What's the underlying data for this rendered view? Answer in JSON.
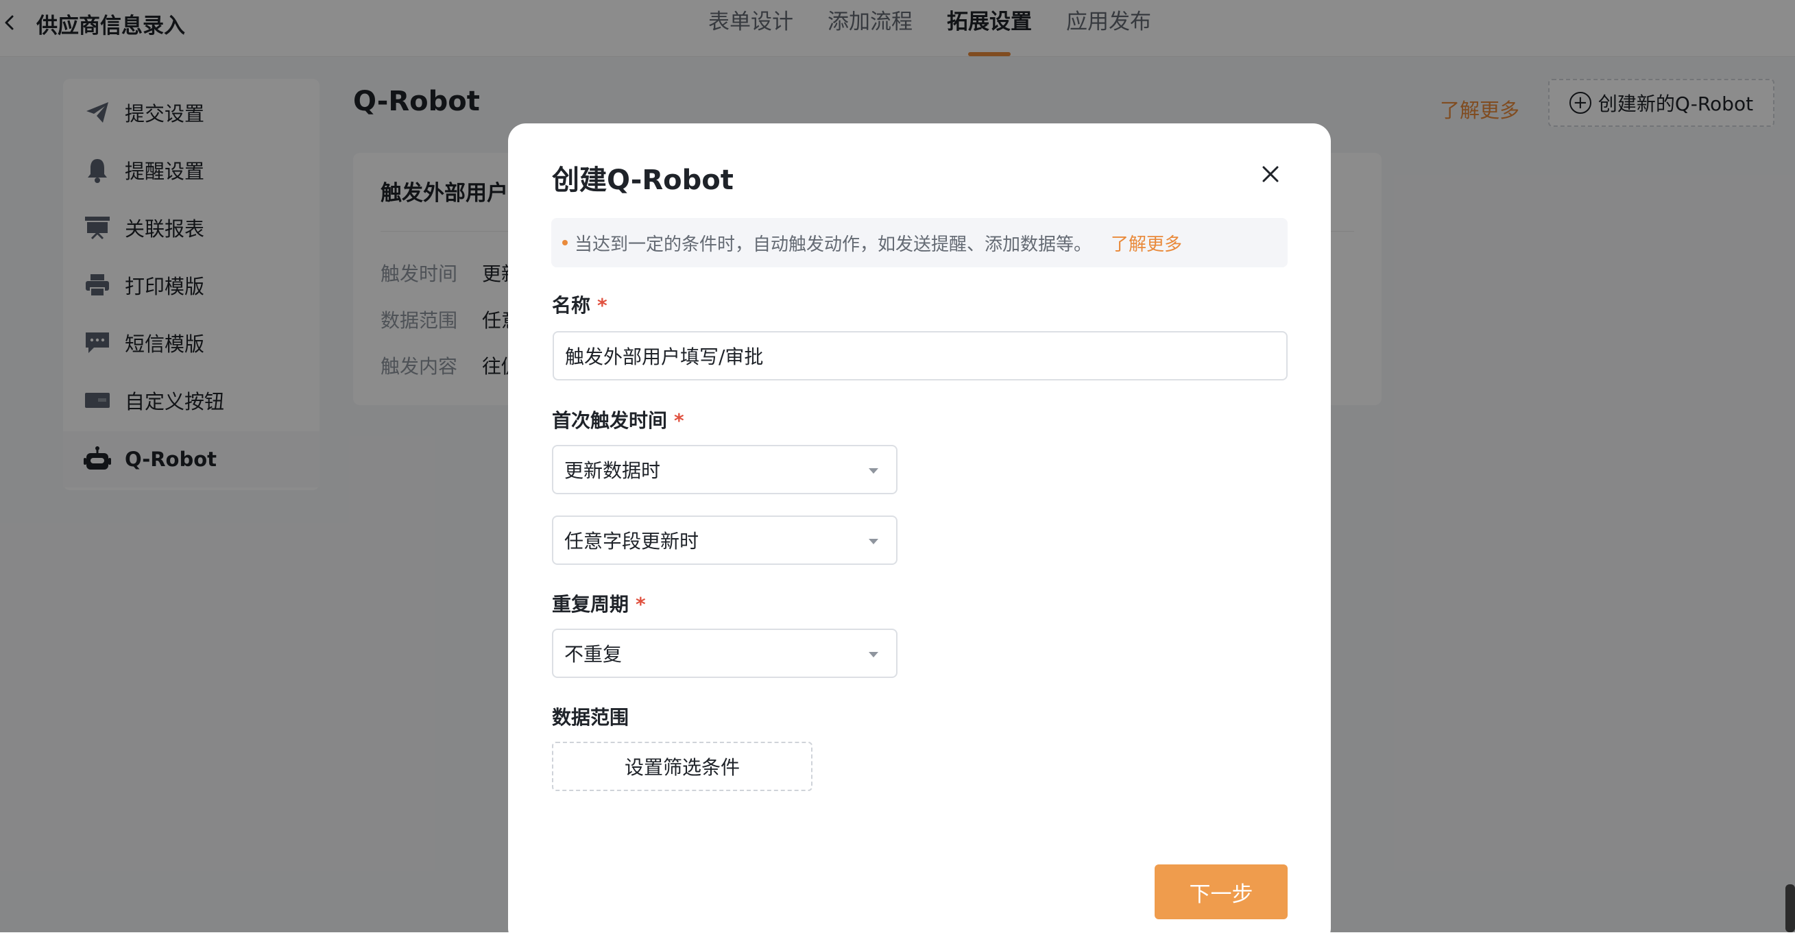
{
  "header": {
    "title": "供应商信息录入",
    "tabs": [
      {
        "label": "表单设计"
      },
      {
        "label": "添加流程"
      },
      {
        "label": "拓展设置"
      },
      {
        "label": "应用发布"
      }
    ]
  },
  "sidebar": {
    "items": [
      {
        "label": "提交设置",
        "icon": "paper-plane-icon"
      },
      {
        "label": "提醒设置",
        "icon": "bell-icon"
      },
      {
        "label": "关联报表",
        "icon": "report-board-icon"
      },
      {
        "label": "打印模版",
        "icon": "printer-icon"
      },
      {
        "label": "短信模版",
        "icon": "message-icon"
      },
      {
        "label": "自定义按钮",
        "icon": "custom-button-icon"
      },
      {
        "label": "Q-Robot",
        "icon": "robot-icon"
      }
    ]
  },
  "main": {
    "section_title": "Q-Robot",
    "learn_more": "了解更多",
    "create_button": "创建新的Q-Robot",
    "card": {
      "title": "触发外部用户",
      "rows": [
        {
          "label": "触发时间",
          "value": "更新"
        },
        {
          "label": "数据范围",
          "value": "任意"
        },
        {
          "label": "触发内容",
          "value": "往促"
        }
      ]
    }
  },
  "modal": {
    "title": "创建Q-Robot",
    "tip_text": "当达到一定的条件时，自动触发动作，如发送提醒、添加数据等。",
    "tip_link": "了解更多",
    "name_label": "名称",
    "name_value": "触发外部用户填写/审批",
    "first_trigger_label": "首次触发时间",
    "first_trigger_value": "更新数据时",
    "field_trigger_value": "任意字段更新时",
    "repeat_label": "重复周期",
    "repeat_value": "不重复",
    "data_range_label": "数据范围",
    "filter_button": "设置筛选条件",
    "next_button": "下一步",
    "required_mark": "*"
  },
  "colors": {
    "accent": "#e98a3b",
    "primary_button": "#ef9c4d",
    "required": "#e0513f"
  }
}
